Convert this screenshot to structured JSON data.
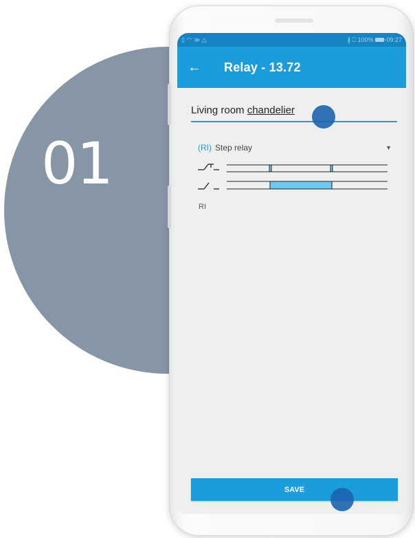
{
  "step": {
    "number": "01"
  },
  "status_bar": {
    "left_icons": "▯ ◠ ≫ △",
    "right_text": "∦ ⎕ 100%",
    "time": "09:27"
  },
  "app_bar": {
    "back_icon": "arrow-left-icon",
    "title": "Relay - 13.72"
  },
  "form": {
    "name_prefix": "Living room ",
    "name_underlined": "chandelier",
    "relay_type_code": "(RI)",
    "relay_type_label": "Step relay",
    "relay_short": "RI"
  },
  "diagram": {
    "input_pulses": [
      "pulse 1",
      "pulse 2"
    ],
    "output_state": "on between pulses"
  },
  "actions": {
    "save_label": "SAVE"
  },
  "colors": {
    "status_bar": "#1683c2",
    "app_bar": "#1b9cdc",
    "accent": "#1b9cdc",
    "touch_indicator": "#1c64ad",
    "step_circle": "#8796a6",
    "output_fill": "#6bc9f2"
  }
}
